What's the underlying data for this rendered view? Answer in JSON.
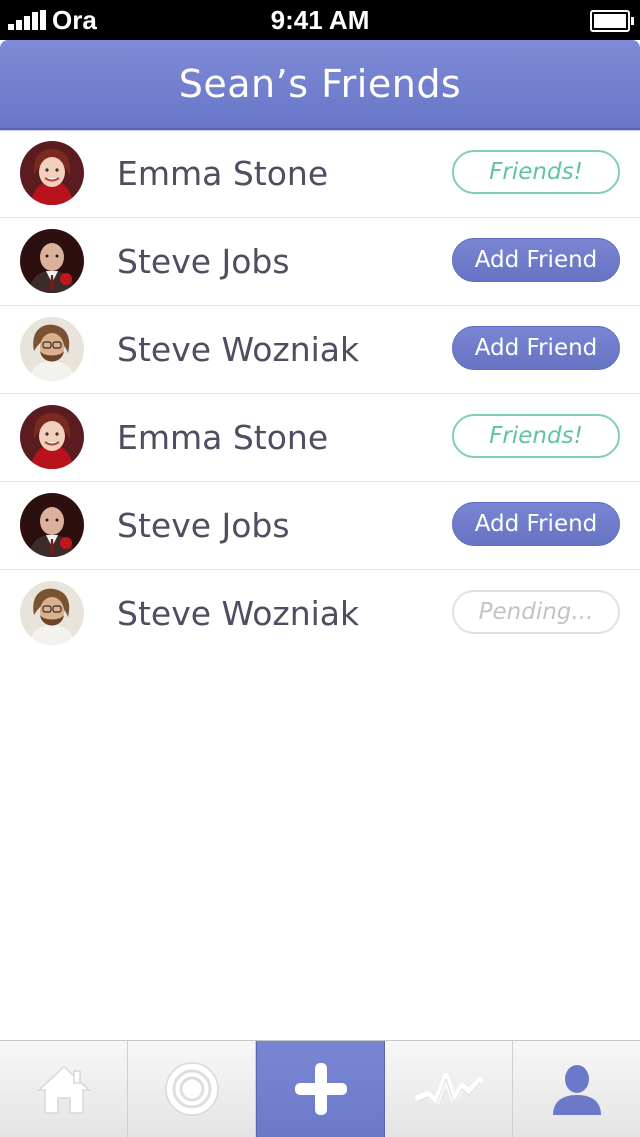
{
  "status_bar": {
    "carrier": "Ora",
    "time": "9:41 AM"
  },
  "nav": {
    "title": "Sean’s Friends"
  },
  "friends": [
    {
      "name": "Emma Stone",
      "status": "Friends!",
      "type": "friends",
      "avatar": "avatar-emma"
    },
    {
      "name": "Steve Jobs",
      "status": "Add Friend",
      "type": "add",
      "avatar": "avatar-jobs"
    },
    {
      "name": "Steve Wozniak",
      "status": "Add Friend",
      "type": "add",
      "avatar": "avatar-woz"
    },
    {
      "name": "Emma Stone",
      "status": "Friends!",
      "type": "friends",
      "avatar": "avatar-emma"
    },
    {
      "name": "Steve Jobs",
      "status": "Add Friend",
      "type": "add",
      "avatar": "avatar-jobs"
    },
    {
      "name": "Steve Wozniak",
      "status": "Pending...",
      "type": "pending",
      "avatar": "avatar-woz"
    }
  ],
  "tabs": [
    {
      "icon": "home-icon",
      "active": false
    },
    {
      "icon": "target-icon",
      "active": false
    },
    {
      "icon": "plus-icon",
      "active": true
    },
    {
      "icon": "activity-icon",
      "active": false
    },
    {
      "icon": "profile-icon",
      "active": false
    }
  ],
  "colors": {
    "accent": "#6f7bcb",
    "friends_green": "#62c2a0",
    "pending_gray": "#c4c4c4",
    "name_text": "#4f4d61"
  }
}
